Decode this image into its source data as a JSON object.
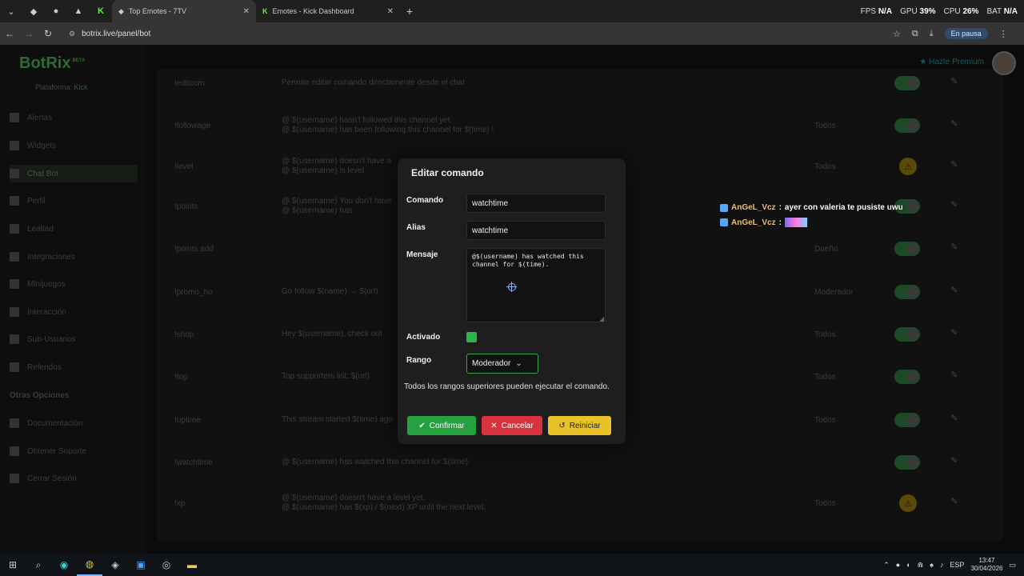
{
  "browser": {
    "tabs": [
      {
        "title": "Top Emotes - 7TV",
        "active": true
      },
      {
        "title": "Emotes - Kick Dashboard",
        "active": false
      }
    ],
    "url": "botrix.live/panel/bot",
    "profile_label": "En pausa",
    "stats": {
      "fps_label": "FPS",
      "fps": "N/A",
      "gpu_label": "GPU",
      "gpu": "39%",
      "cpu_label": "CPU",
      "cpu": "26%",
      "bat_label": "BAT",
      "bat": "N/A"
    }
  },
  "app": {
    "logo": "BotRix",
    "logo_tag": "BETA",
    "platform_label": "Plataforma:",
    "platform_value": "Kick",
    "premium": "Hazte Premium",
    "sidebar": [
      {
        "label": "Alertas"
      },
      {
        "label": "Widgets"
      },
      {
        "label": "Chat Bot",
        "active": true
      },
      {
        "label": "Perfil"
      },
      {
        "label": "Lealtad"
      },
      {
        "label": "Integraciones"
      },
      {
        "label": "Minijuegos"
      },
      {
        "label": "Interacción"
      },
      {
        "label": "Sub-Usuarios"
      },
      {
        "label": "Referidos"
      }
    ],
    "sidebar_section": "Otras Opciones",
    "sidebar_extra": [
      {
        "label": "Documentación"
      },
      {
        "label": "Obtener Soporte"
      },
      {
        "label": "Cerrar Sesión"
      }
    ]
  },
  "commands": [
    {
      "name": "!editcom",
      "message": "Permite editar comando directamente desde el chat",
      "rank": "",
      "state": "toggle"
    },
    {
      "name": "!followage",
      "message": "@ $(username) hasn't followed this channel yet.\n@ $(username) has been following this channel for $(time) !",
      "rank": "Todos",
      "state": "toggle"
    },
    {
      "name": "!level",
      "message": "@ $(username) doesn't have a\n@ $(username) is level",
      "rank": "Todos",
      "state": "warn"
    },
    {
      "name": "!points",
      "message": "@ $(username) You don't have\n@ $(username) has",
      "rank": "",
      "state": "toggle"
    },
    {
      "name": "!points add",
      "message": "",
      "rank": "Dueño",
      "state": "toggle"
    },
    {
      "name": "!promo_ho",
      "message": "Go follow $(name) → $(url)",
      "rank": "Moderador",
      "state": "toggle"
    },
    {
      "name": "!shop",
      "message": "Hey $(username), check out",
      "rank": "Todos",
      "state": "toggle"
    },
    {
      "name": "!top",
      "message": "Top supporters list: $(url)",
      "rank": "Todos",
      "state": "toggle"
    },
    {
      "name": "!uptime",
      "message": "This stream started $(time) ago",
      "rank": "Todos",
      "state": "toggle"
    },
    {
      "name": "!watchtime",
      "message": "@ $(username) has watched this channel for $(time).",
      "rank": "",
      "state": "toggle"
    },
    {
      "name": "!xp",
      "message": "@ $(username) doesn't have a level yet.\n@ $(username) has $(xp) / $(next) XP until the next level.",
      "rank": "Todos",
      "state": "warn"
    }
  ],
  "chat_overlay": [
    {
      "user": "AnGeL_Vcz",
      "sep": ":",
      "text": "ayer con valeria te pusiste uwu",
      "emote": false
    },
    {
      "user": "AnGeL_Vcz",
      "sep": ":",
      "text": "",
      "emote": true
    }
  ],
  "modal": {
    "title": "Editar comando",
    "command_label": "Comando",
    "command_value": "watchtime",
    "alias_label": "Alias",
    "alias_value": "watchtime",
    "message_label": "Mensaje",
    "message_value": "@$(username) has watched this channel for $(time).",
    "enabled_label": "Activado",
    "enabled": true,
    "rank_label": "Rango",
    "rank_value": "Moderador",
    "hint": "Todos los rangos superiores pueden ejecutar el comando.",
    "confirm": "Confirmar",
    "cancel": "Cancelar",
    "reset": "Reiniciar"
  },
  "taskbar": {
    "lang": "ESP",
    "time": "13:47",
    "date": "30/04/2026"
  },
  "colors": {
    "accent_green": "#23a23f",
    "cancel_red": "#d8323f",
    "reset_yellow": "#e9c22a"
  }
}
